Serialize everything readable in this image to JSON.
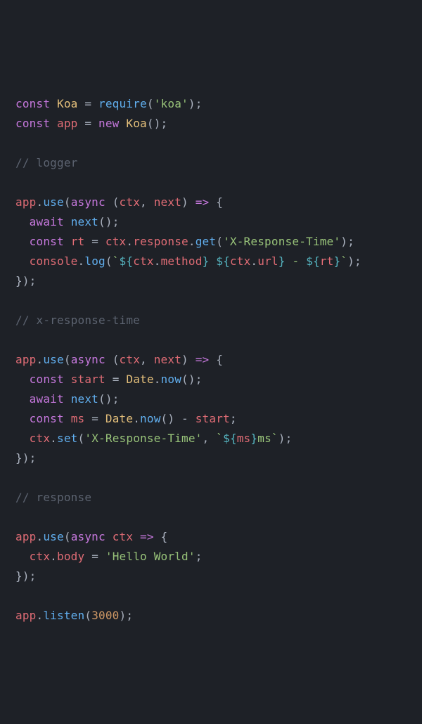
{
  "l1": {
    "kw_const": "const",
    "Koa": "Koa",
    "eq": " = ",
    "require": "require",
    "paren_o": "(",
    "str": "'koa'",
    "paren_c": ");"
  },
  "l2": {
    "kw_const": "const",
    "app": "app",
    "eq": " = ",
    "new": "new",
    "Koa": "Koa",
    "call": "();"
  },
  "l4": {
    "cm": "// logger"
  },
  "l6": {
    "app": "app",
    "dot": ".",
    "use": "use",
    "paren_o": "(",
    "async": "async",
    "args": " (",
    "ctx": "ctx",
    "comma": ", ",
    "next": "next",
    "arrow": ") ",
    "fat": "=>",
    "brace": " {"
  },
  "l7": {
    "indent": "  ",
    "await": "await",
    "sp": " ",
    "next": "next",
    "call": "();"
  },
  "l8": {
    "indent": "  ",
    "const": "const",
    "sp": " ",
    "rt": "rt",
    "eq": " = ",
    "ctx": "ctx",
    "dot1": ".",
    "response": "response",
    "dot2": ".",
    "get": "get",
    "paren_o": "(",
    "str": "'X-Response-Time'",
    "paren_c": ");"
  },
  "l9": {
    "indent": "  ",
    "console": "console",
    "dot": ".",
    "log": "log",
    "paren_o": "(",
    "bt1": "`",
    "i1o": "${",
    "ctx1": "ctx",
    "cd1": ".",
    "method": "method",
    "i1c": "}",
    "sp1": " ",
    "i2o": "${",
    "ctx2": "ctx",
    "cd2": ".",
    "url": "url",
    "i2c": "}",
    "dash": " - ",
    "i3o": "${",
    "rtv": "rt",
    "i3c": "}",
    "bt2": "`",
    "paren_c": ");"
  },
  "l10": {
    "close": "});"
  },
  "l12": {
    "cm": "// x-response-time"
  },
  "l14": {
    "app": "app",
    "dot": ".",
    "use": "use",
    "paren_o": "(",
    "async": "async",
    "args": " (",
    "ctx": "ctx",
    "comma": ", ",
    "next": "next",
    "arrow": ") ",
    "fat": "=>",
    "brace": " {"
  },
  "l15": {
    "indent": "  ",
    "const": "const",
    "sp": " ",
    "start": "start",
    "eq": " = ",
    "Date": "Date",
    "dot": ".",
    "now": "now",
    "call": "();"
  },
  "l16": {
    "indent": "  ",
    "await": "await",
    "sp": " ",
    "next": "next",
    "call": "();"
  },
  "l17": {
    "indent": "  ",
    "const": "const",
    "sp": " ",
    "ms": "ms",
    "eq": " = ",
    "Date": "Date",
    "dot": ".",
    "now": "now",
    "call": "()",
    "minus": " - ",
    "start": "start",
    "semi": ";"
  },
  "l18": {
    "indent": "  ",
    "ctx": "ctx",
    "dot": ".",
    "set": "set",
    "paren_o": "(",
    "str": "'X-Response-Time'",
    "comma": ", ",
    "bt1": "`",
    "io": "${",
    "msv": "ms",
    "ic": "}",
    "mss": "ms",
    "bt2": "`",
    "paren_c": ");"
  },
  "l19": {
    "close": "});"
  },
  "l21": {
    "cm": "// response"
  },
  "l23": {
    "app": "app",
    "dot": ".",
    "use": "use",
    "paren_o": "(",
    "async": "async",
    "sp": " ",
    "ctx": "ctx",
    "sp2": " ",
    "fat": "=>",
    "brace": " {"
  },
  "l24": {
    "indent": "  ",
    "ctx": "ctx",
    "dot": ".",
    "body": "body",
    "eq": " = ",
    "str": "'Hello World'",
    "semi": ";"
  },
  "l25": {
    "close": "});"
  },
  "l27": {
    "app": "app",
    "dot": ".",
    "listen": "listen",
    "paren_o": "(",
    "num": "3000",
    "paren_c": ");"
  }
}
